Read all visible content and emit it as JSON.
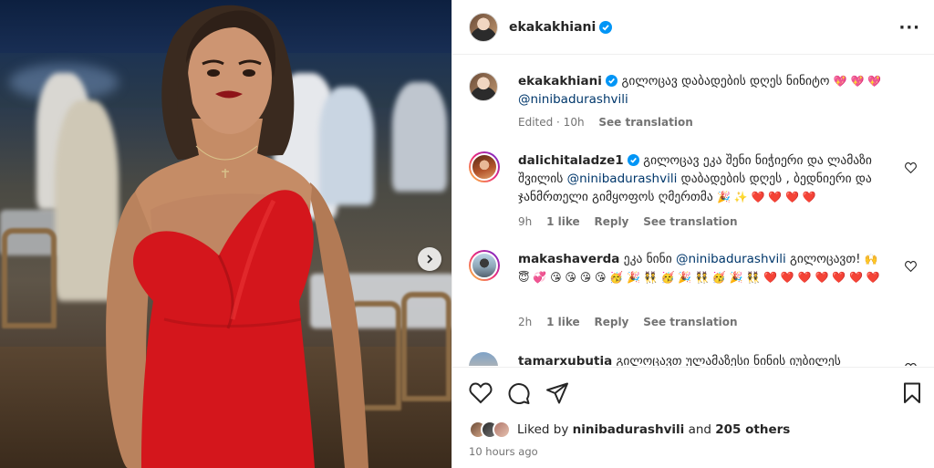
{
  "post": {
    "author": "ekakakhiani",
    "media": {
      "carousel_next": "chevron-right"
    }
  },
  "caption": {
    "author": "ekakakhiani",
    "text": "გილოცავ დაბადების დღეს ნინიტო",
    "emoji": "💖 💖 💖",
    "mention": "@ninibadurashvili",
    "edited": "Edited · 10h",
    "see_translation": "See translation"
  },
  "comments": [
    {
      "username": "dalichitaladze1",
      "text_before": "გილოცავ ეკა შენი ნიჭიერი და ლამაზი შვილის",
      "mention": "@ninibadurashvili",
      "text_after": "დაბადების დღეს , ბედნიერი და ჯანმრთელი გიმყოფოს ღმერთმა",
      "emoji": "🎉 ✨ ❤️ ❤️ ❤️ ❤️",
      "time": "9h",
      "likes": "1 like",
      "reply": "Reply",
      "see_translation": "See translation"
    },
    {
      "username": "makashaverda",
      "text_before": "ეკა ნინი",
      "mention": "@ninibadurashvili",
      "text_after": "გილოცავთ!",
      "emoji": "🙌 😇 💞 😘 😘 😘 😘 🥳 🎉 👯 🥳 🎉 👯 🥳 🎉 👯 ❤️ ❤️ ❤️ ❤️ ❤️ ❤️ ❤️",
      "time": "2h",
      "likes": "1 like",
      "reply": "Reply",
      "see_translation": "See translation"
    },
    {
      "username": "tamarxubutia",
      "text": "გილოცავთ ულამაზესი ნინის იუბილეს"
    }
  ],
  "actions": {
    "like": "heart-icon",
    "comment": "comment-icon",
    "share": "share-icon",
    "save": "bookmark-icon"
  },
  "likes": {
    "prefix": "Liked by",
    "user": "ninibadurashvili",
    "and": "and",
    "others": "205 others"
  },
  "timestamp": "10 hours ago",
  "colors": {
    "verified": "#0095f6",
    "link": "#00376b",
    "muted": "#737373",
    "dress_red": "#d4161c"
  }
}
